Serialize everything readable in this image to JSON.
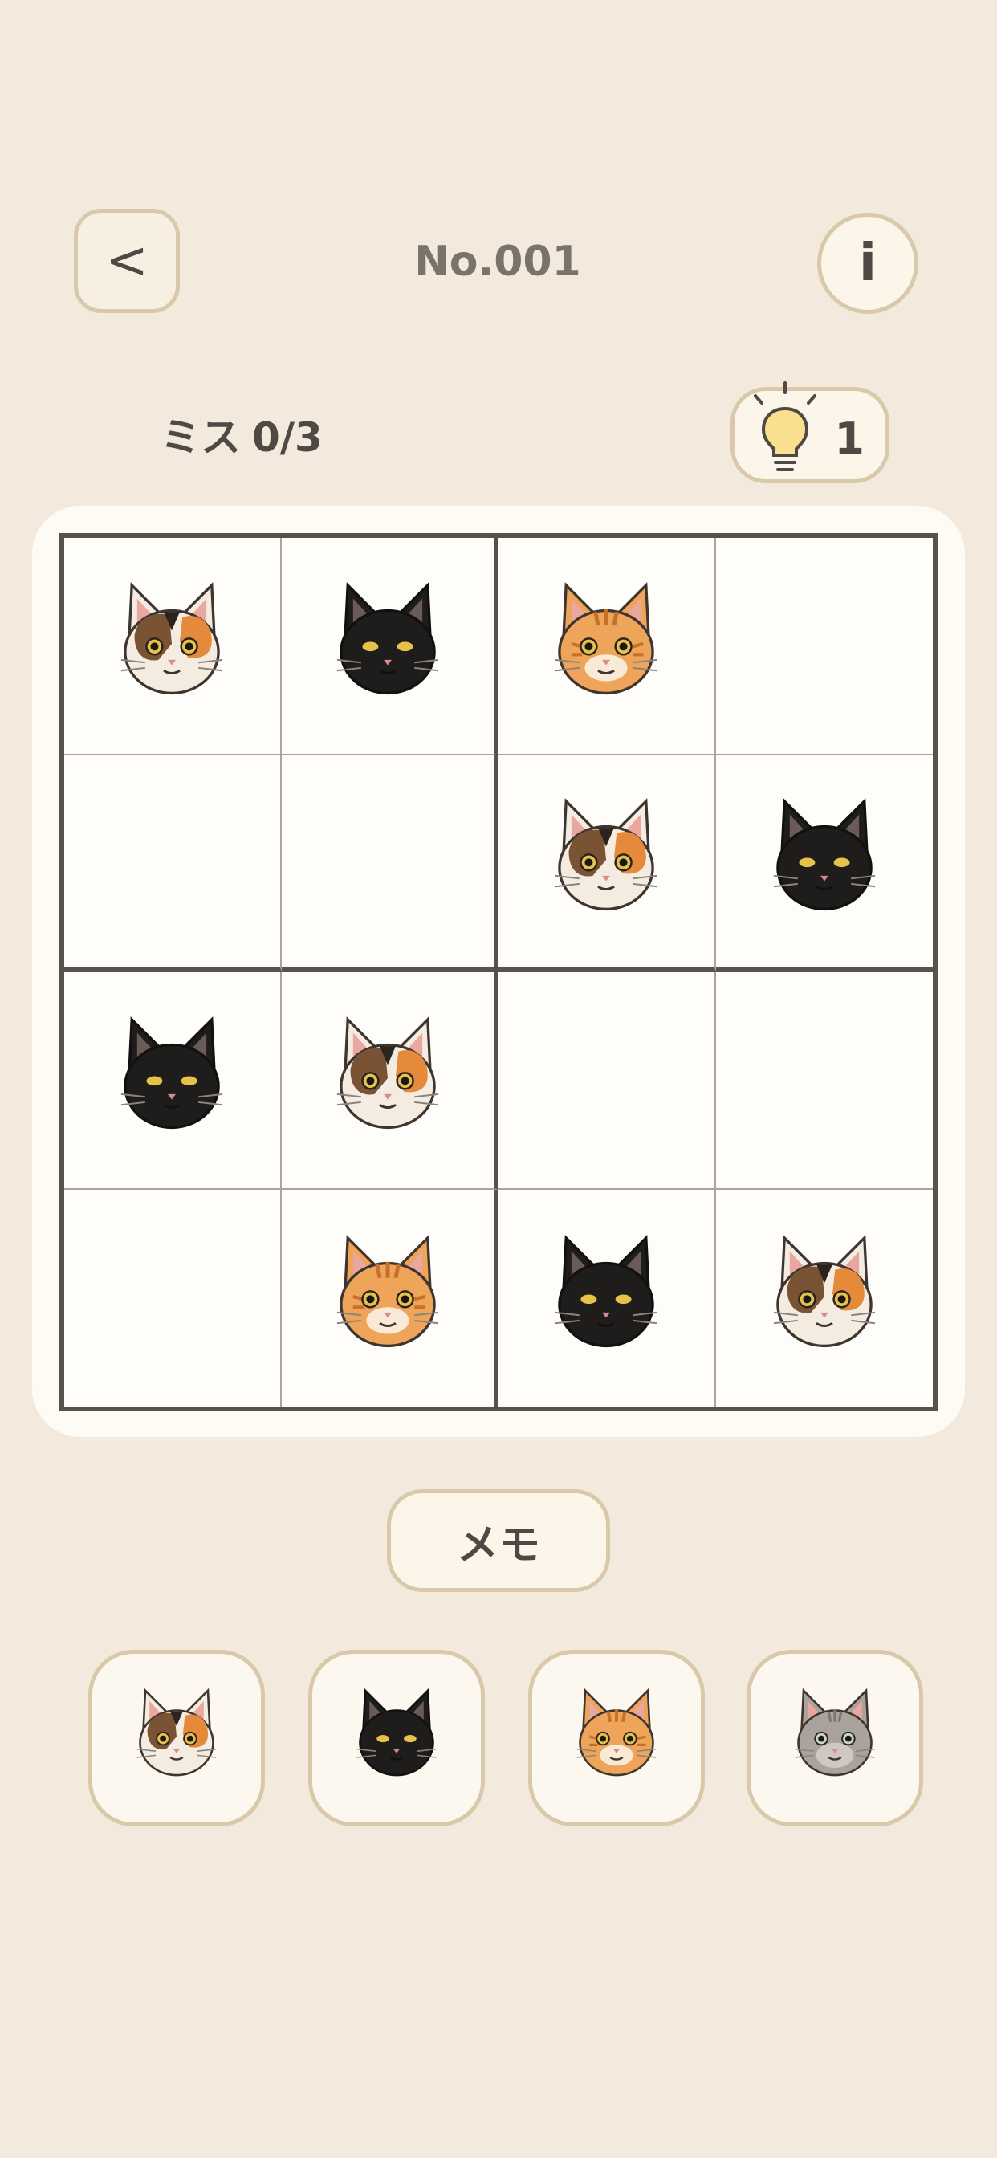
{
  "header": {
    "back_label": "<",
    "title": "No.001",
    "info_label": "i"
  },
  "status": {
    "miss_label": "ミス",
    "miss_value": "0/3",
    "hint_count": "1"
  },
  "board": {
    "rows": [
      [
        "calico-cat",
        "black-cat",
        "orange-cat",
        ""
      ],
      [
        "",
        "",
        "calico-cat",
        "black-cat"
      ],
      [
        "black-cat",
        "calico-cat",
        "",
        ""
      ],
      [
        "",
        "orange-cat",
        "black-cat",
        "calico-cat"
      ]
    ]
  },
  "memo": {
    "label": "メモ"
  },
  "palette": [
    "calico-cat",
    "black-cat",
    "orange-cat",
    "gray-cat"
  ],
  "colors": {
    "background": "#f3eadd",
    "button_border": "#d9c9aa",
    "grid_line": "#57524c"
  }
}
